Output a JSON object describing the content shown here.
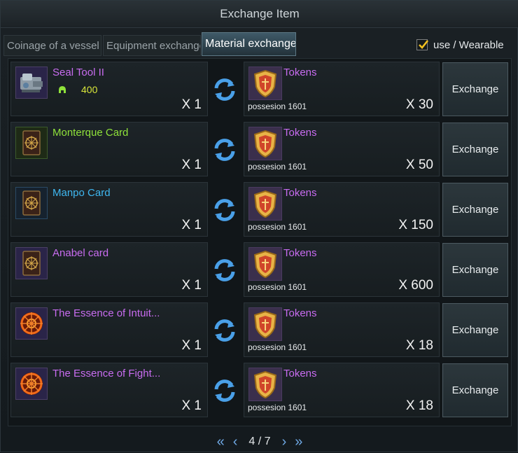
{
  "window": {
    "title": "Exchange Item"
  },
  "tabs": [
    {
      "label": "Coinage of a vessel"
    },
    {
      "label": "Equipment exchange"
    },
    {
      "label": "Material exchange"
    }
  ],
  "filter": {
    "checked": true,
    "label": "use / Wearable"
  },
  "rows": [
    {
      "item": {
        "name": "Seal Tool II",
        "color": "#c86cf0",
        "qty": "X 1",
        "stat_value": "400",
        "icon": "seal-tool-icon"
      },
      "reward": {
        "name": "Tokens",
        "possession": "possesion 1601",
        "qty": "X 30",
        "icon": "token-shield-icon"
      },
      "button": "Exchange"
    },
    {
      "item": {
        "name": "Monterque Card",
        "color": "#8fe23a",
        "qty": "X 1",
        "icon": "card-icon"
      },
      "reward": {
        "name": "Tokens",
        "possession": "possesion 1601",
        "qty": "X 50",
        "icon": "token-shield-icon"
      },
      "button": "Exchange"
    },
    {
      "item": {
        "name": "Manpo Card",
        "color": "#3fb7f0",
        "qty": "X 1",
        "icon": "card-icon"
      },
      "reward": {
        "name": "Tokens",
        "possession": "possesion 1601",
        "qty": "X 150",
        "icon": "token-shield-icon"
      },
      "button": "Exchange"
    },
    {
      "item": {
        "name": "Anabel card",
        "color": "#c86cf0",
        "qty": "X 1",
        "icon": "card-icon"
      },
      "reward": {
        "name": "Tokens",
        "possession": "possesion 1601",
        "qty": "X 600",
        "icon": "token-shield-icon"
      },
      "button": "Exchange"
    },
    {
      "item": {
        "name": "The Essence of Intuit...",
        "color": "#c86cf0",
        "qty": "X 1",
        "icon": "essence-icon"
      },
      "reward": {
        "name": "Tokens",
        "possession": "possesion 1601",
        "qty": "X 18",
        "icon": "token-shield-icon"
      },
      "button": "Exchange"
    },
    {
      "item": {
        "name": "The Essence of Fight...",
        "color": "#c86cf0",
        "qty": "X 1",
        "icon": "essence-icon"
      },
      "reward": {
        "name": "Tokens",
        "possession": "possesion 1601",
        "qty": "X 18",
        "icon": "token-shield-icon"
      },
      "button": "Exchange"
    }
  ],
  "pagination": {
    "page": "4 / 7"
  },
  "colors": {
    "reward_name": "#c86cf0",
    "accent": "#6fa9e5",
    "checkmark": "#f0c020"
  }
}
